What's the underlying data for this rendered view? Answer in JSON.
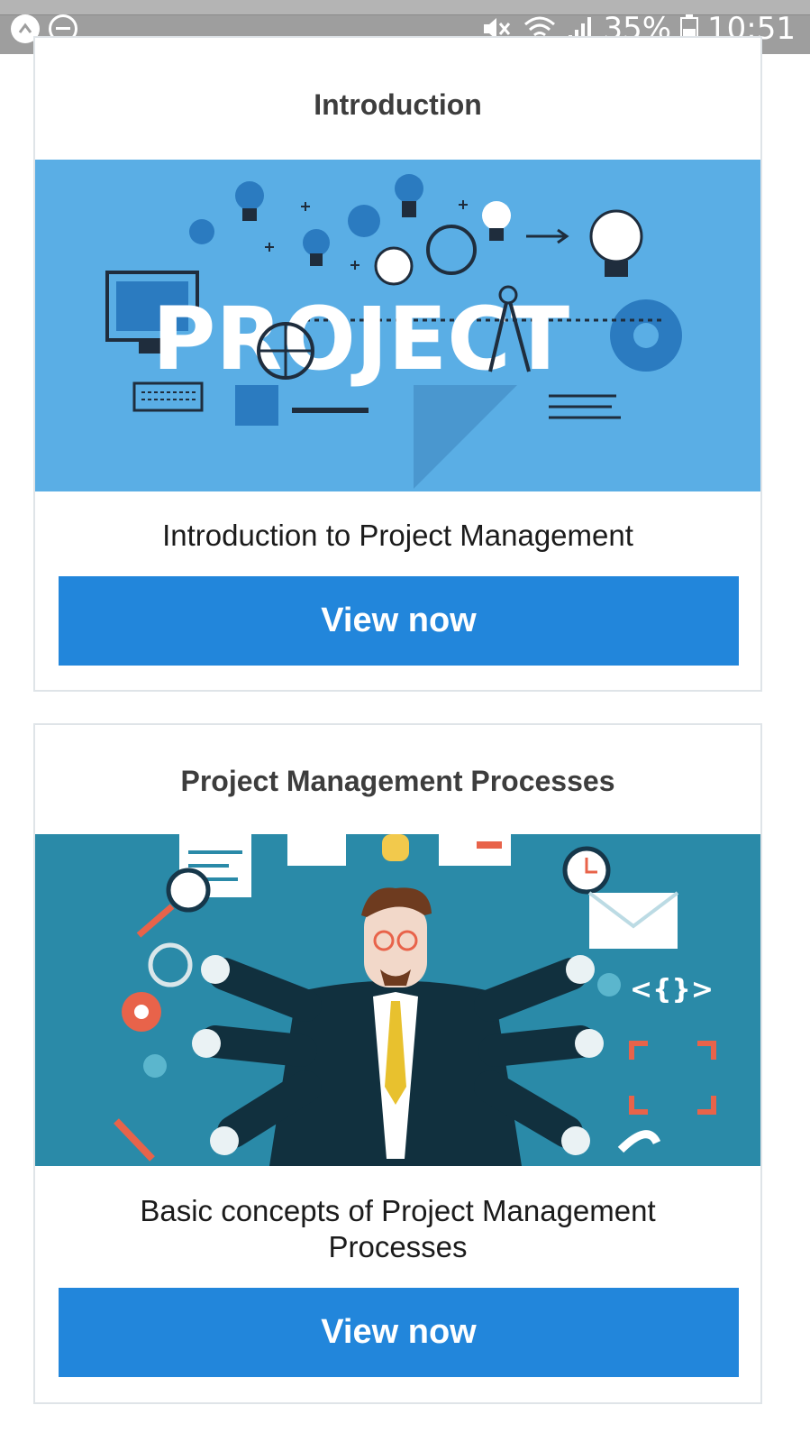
{
  "status_bar": {
    "battery": "35%",
    "time": "10:51",
    "icons": [
      "notification-arrow-icon",
      "do-not-disturb-icon",
      "mute-icon",
      "wifi-icon",
      "signal-icon",
      "battery-icon"
    ]
  },
  "courses": [
    {
      "title": "Introduction",
      "banner_text": "PROJECT",
      "description": "Introduction to Project Management",
      "button_label": "View now"
    },
    {
      "title": "Project Management Processes",
      "description": "Basic concepts of Project Management Processes",
      "button_label": "View now"
    }
  ],
  "colors": {
    "accent": "#2286db",
    "banner1": "#5aaee5",
    "banner2": "#2a8aa8"
  }
}
